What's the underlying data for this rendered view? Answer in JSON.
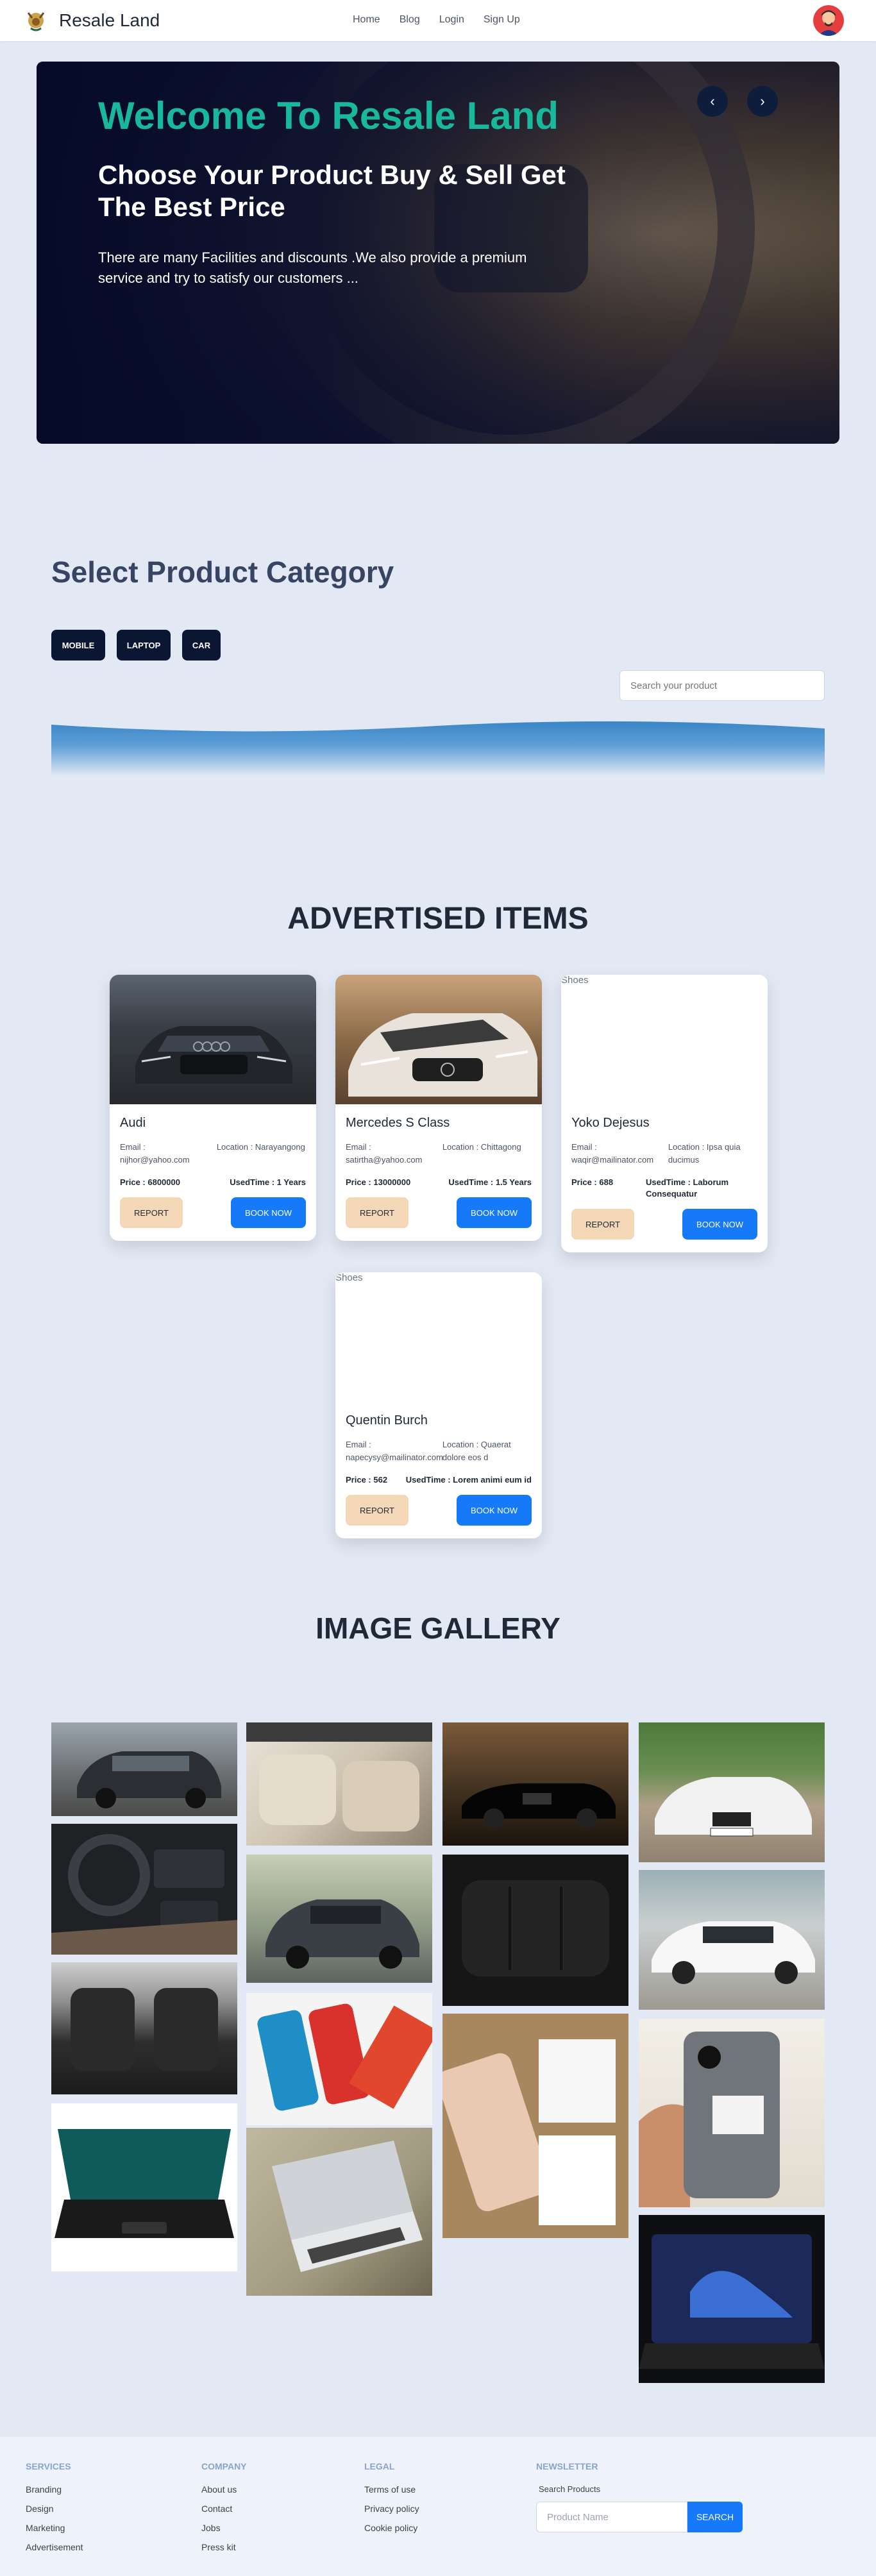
{
  "nav": {
    "brand": "Resale Land",
    "links": [
      "Home",
      "Blog",
      "Login",
      "Sign Up"
    ]
  },
  "hero": {
    "title": "Welcome To Resale Land",
    "subtitle": "Choose Your Product Buy & Sell Get The Best Price",
    "text": "There are many Facilities and discounts .We also provide a premium service and try to satisfy our customers ...",
    "prev_icon": "‹",
    "next_icon": "›"
  },
  "category": {
    "title": "Select Product Category",
    "buttons": [
      "MOBILE",
      "LAPTOP",
      "CAR"
    ],
    "search_placeholder": "Search your product"
  },
  "advertised": {
    "title": "ADVERTISED ITEMS",
    "report_label": "REPORT",
    "book_label": "BOOK NOW",
    "alt_text": "Shoes",
    "cards": [
      {
        "name": "Audi",
        "email": "Email : nijhor@yahoo.com",
        "location": "Location : Narayangong",
        "price": "Price : 6800000",
        "used": "UsedTime : 1 Years"
      },
      {
        "name": "Mercedes S Class",
        "email": "Email : satirtha@yahoo.com",
        "location": "Location : Chittagong",
        "price": "Price : 13000000",
        "used": "UsedTime : 1.5 Years"
      },
      {
        "name": "Yoko Dejesus",
        "email": "Email : waqir@mailinator.com",
        "location": "Location : Ipsa quia ducimus",
        "price": "Price : 688",
        "used": "UsedTime : Laborum Consequatur"
      },
      {
        "name": "Quentin Burch",
        "email": "Email : napecysy@mailinator.com",
        "location": "Location : Quaerat dolore eos d",
        "price": "Price : 562",
        "used": "UsedTime : Lorem animi eum id"
      }
    ]
  },
  "gallery": {
    "title": "IMAGE GALLERY"
  },
  "footer": {
    "services": {
      "head": "SERVICES",
      "items": [
        "Branding",
        "Design",
        "Marketing",
        "Advertisement"
      ]
    },
    "company": {
      "head": "COMPANY",
      "items": [
        "About us",
        "Contact",
        "Jobs",
        "Press kit"
      ]
    },
    "legal": {
      "head": "LEGAL",
      "items": [
        "Terms of use",
        "Privacy policy",
        "Cookie policy"
      ]
    },
    "newsletter": {
      "head": "NEWSLETTER",
      "label": "Search Products",
      "placeholder": "Product Name",
      "button": "SEARCH"
    }
  },
  "colors": {
    "accent": "#19b89c",
    "dark": "#0b1633",
    "primary": "#1679f7",
    "report": "#f3d7b7",
    "background": "#e2e8f4"
  }
}
